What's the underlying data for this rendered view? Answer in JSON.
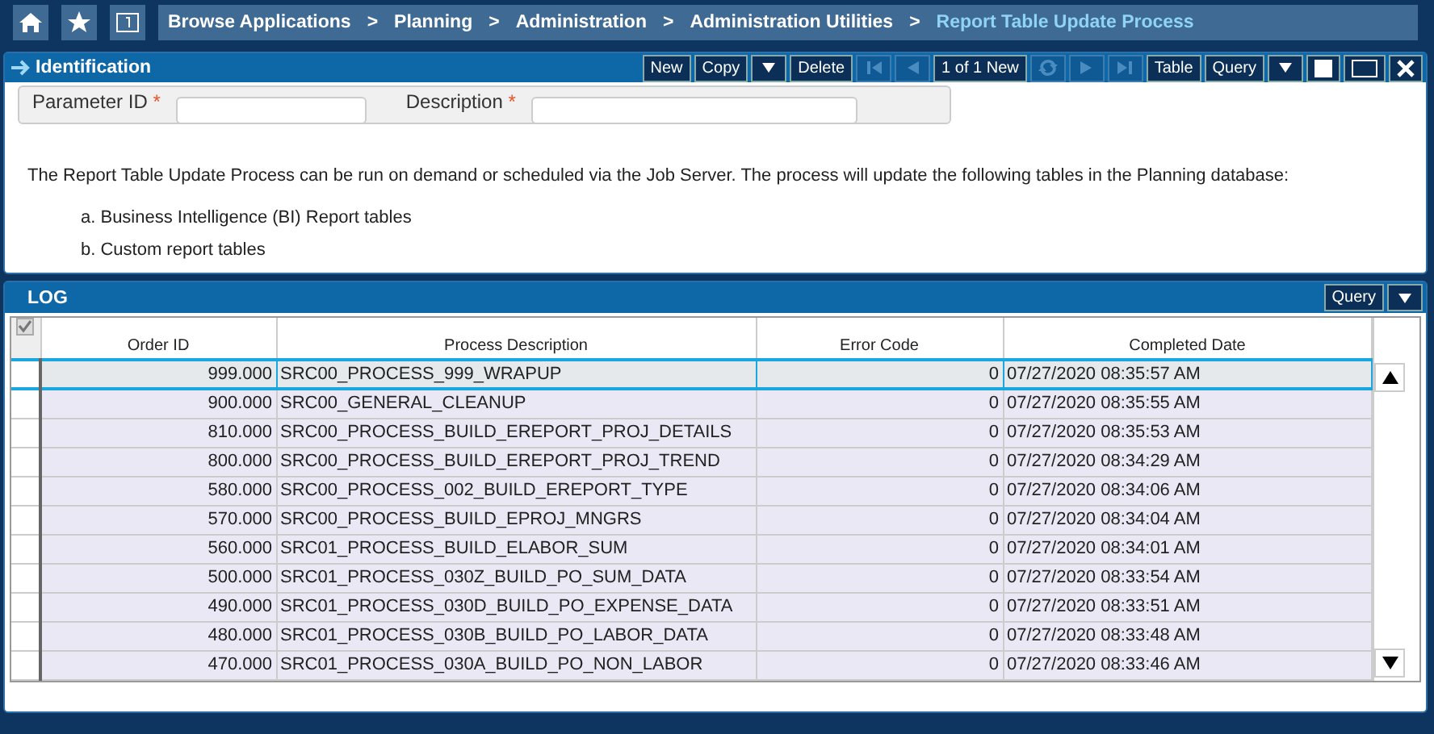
{
  "breadcrumb": [
    {
      "label": "Browse Applications",
      "current": false
    },
    {
      "label": "Planning",
      "current": false
    },
    {
      "label": "Administration",
      "current": false
    },
    {
      "label": "Administration Utilities",
      "current": false
    },
    {
      "label": "Report Table Update Process",
      "current": true
    }
  ],
  "breadcrumb_separator": ">",
  "identification": {
    "title": "Identification",
    "toolbar": [
      {
        "kind": "text",
        "label": "New",
        "disabled": false
      },
      {
        "kind": "text",
        "label": "Copy",
        "disabled": false
      },
      {
        "kind": "caret",
        "disabled": false
      },
      {
        "kind": "text",
        "label": "Delete",
        "disabled": false
      },
      {
        "kind": "first",
        "disabled": true
      },
      {
        "kind": "prev",
        "disabled": true
      },
      {
        "kind": "text",
        "label": "1 of 1 New",
        "disabled": false
      },
      {
        "kind": "refresh",
        "disabled": true
      },
      {
        "kind": "next",
        "disabled": true
      },
      {
        "kind": "last",
        "disabled": true
      },
      {
        "kind": "text",
        "label": "Table",
        "disabled": false
      },
      {
        "kind": "text",
        "label": "Query",
        "disabled": false
      },
      {
        "kind": "caret",
        "disabled": false
      },
      {
        "kind": "square",
        "disabled": false
      },
      {
        "kind": "window",
        "disabled": false
      },
      {
        "kind": "close",
        "disabled": false
      }
    ],
    "fields": [
      {
        "label": "Parameter ID",
        "marker": "*"
      },
      {
        "label": "Description",
        "marker": "*"
      }
    ],
    "intro": "The Report Table Update Process can be run on demand or scheduled via the Job Server. The process will update the following tables in the Planning database:",
    "list": [
      "a. Business Intelligence (BI) Report tables",
      "b. Custom report tables"
    ]
  },
  "log": {
    "title": "LOG",
    "toolbar": [
      {
        "kind": "text",
        "label": "Query"
      },
      {
        "kind": "caret"
      }
    ],
    "select_all": {
      "checked": true
    },
    "columns": [
      "Order ID",
      "Process Description",
      "Error Code",
      "Completed Date"
    ],
    "rows": [
      {
        "cells": [
          "999.000",
          "SRC00_PROCESS_999_WRAPUP",
          "0",
          "07/27/2020 08:35:57 AM"
        ],
        "selected": true
      },
      {
        "cells": [
          "900.000",
          "SRC00_GENERAL_CLEANUP",
          "0",
          "07/27/2020 08:35:55 AM"
        ],
        "selected": false
      },
      {
        "cells": [
          "810.000",
          "SRC00_PROCESS_BUILD_EREPORT_PROJ_DETAILS",
          "0",
          "07/27/2020 08:35:53 AM"
        ],
        "selected": false
      },
      {
        "cells": [
          "800.000",
          "SRC00_PROCESS_BUILD_EREPORT_PROJ_TREND",
          "0",
          "07/27/2020 08:34:29 AM"
        ],
        "selected": false
      },
      {
        "cells": [
          "580.000",
          "SRC00_PROCESS_002_BUILD_EREPORT_TYPE",
          "0",
          "07/27/2020 08:34:06 AM"
        ],
        "selected": false
      },
      {
        "cells": [
          "570.000",
          "SRC00_PROCESS_BUILD_EPROJ_MNGRS",
          "0",
          "07/27/2020 08:34:04 AM"
        ],
        "selected": false
      },
      {
        "cells": [
          "560.000",
          "SRC01_PROCESS_BUILD_ELABOR_SUM",
          "0",
          "07/27/2020 08:34:01 AM"
        ],
        "selected": false
      },
      {
        "cells": [
          "500.000",
          "SRC01_PROCESS_030Z_BUILD_PO_SUM_DATA",
          "0",
          "07/27/2020 08:33:54 AM"
        ],
        "selected": false
      },
      {
        "cells": [
          "490.000",
          "SRC01_PROCESS_030D_BUILD_PO_EXPENSE_DATA",
          "0",
          "07/27/2020 08:33:51 AM"
        ],
        "selected": false
      },
      {
        "cells": [
          "480.000",
          "SRC01_PROCESS_030B_BUILD_PO_LABOR_DATA",
          "0",
          "07/27/2020 08:33:48 AM"
        ],
        "selected": false
      },
      {
        "cells": [
          "470.000",
          "SRC01_PROCESS_030A_BUILD_PO_NON_LABOR",
          "0",
          "07/27/2020 08:33:46 AM"
        ],
        "selected": false
      }
    ]
  }
}
